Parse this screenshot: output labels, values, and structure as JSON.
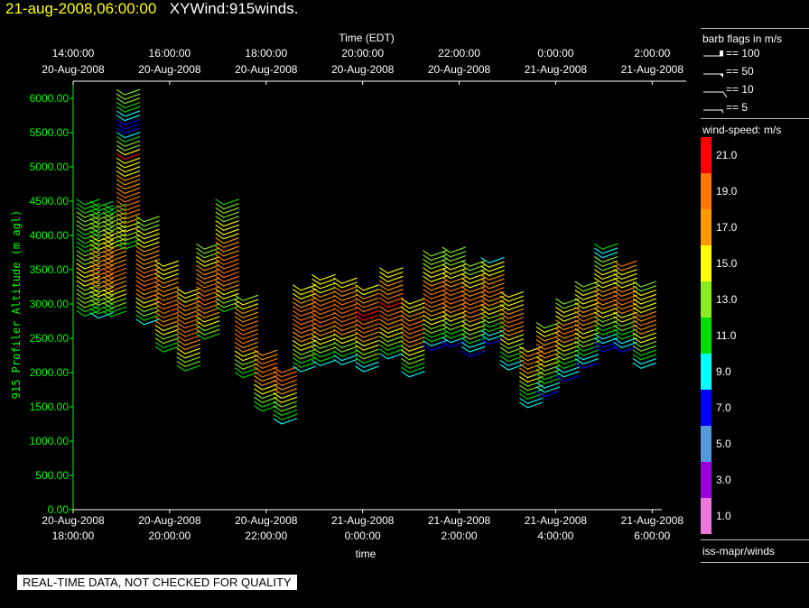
{
  "header": {
    "date_label": "21-aug-2008,06:00:00",
    "title": "XYWind:915winds."
  },
  "notice": "REAL-TIME DATA, NOT CHECKED FOR QUALITY",
  "legend": {
    "barb_title": "barb flags in m/s",
    "barb_items": [
      "== 100",
      "== 50",
      "== 10",
      "== 5"
    ],
    "colorbar_title": "wind-speed: m/s",
    "colorbar": [
      {
        "label": "21.0",
        "color": "#ff0000"
      },
      {
        "label": "19.0",
        "color": "#ff7700"
      },
      {
        "label": "17.0",
        "color": "#ff9900"
      },
      {
        "label": "15.0",
        "color": "#ffff00"
      },
      {
        "label": "13.0",
        "color": "#88ee22"
      },
      {
        "label": "11.0",
        "color": "#00dd00"
      },
      {
        "label": "9.0",
        "color": "#00ffff"
      },
      {
        "label": "7.0",
        "color": "#0000ff"
      },
      {
        "label": "5.0",
        "color": "#5599dd"
      },
      {
        "label": "3.0",
        "color": "#9900dd"
      },
      {
        "label": "1.0",
        "color": "#ee77dd"
      }
    ],
    "source": "iss-mapr/winds"
  },
  "chart_data": {
    "type": "scatter",
    "title": "XYWind:915winds.",
    "ylabel": "915 Profiler Altitude (m agl)",
    "xlabel_bottom": "time",
    "xlabel_top": "Time (EDT)",
    "ylim": [
      0,
      6250
    ],
    "yticks": [
      "0.00",
      "500.00",
      "1000.00",
      "1500.00",
      "2000.00",
      "2500.00",
      "3000.00",
      "3500.00",
      "4000.00",
      "4500.00",
      "5000.00",
      "5500.00",
      "6000.00"
    ],
    "xlim_hours_utc": [
      18.0,
      30.2
    ],
    "xticks_bottom": [
      {
        "hour": 18,
        "line1": "20-Aug-2008",
        "line2": "18:00:00"
      },
      {
        "hour": 20,
        "line1": "20-Aug-2008",
        "line2": "20:00:00"
      },
      {
        "hour": 22,
        "line1": "20-Aug-2008",
        "line2": "22:00:00"
      },
      {
        "hour": 24,
        "line1": "21-Aug-2008",
        "line2": "0:00:00"
      },
      {
        "hour": 26,
        "line1": "21-Aug-2008",
        "line2": "2:00:00"
      },
      {
        "hour": 28,
        "line1": "21-Aug-2008",
        "line2": "4:00:00"
      },
      {
        "hour": 30,
        "line1": "21-Aug-2008",
        "line2": "6:00:00"
      }
    ],
    "xticks_top": [
      {
        "hour": 18,
        "line1": "14:00:00",
        "line2": "20-Aug-2008"
      },
      {
        "hour": 20,
        "line1": "16:00:00",
        "line2": "20-Aug-2008"
      },
      {
        "hour": 22,
        "line1": "18:00:00",
        "line2": "20-Aug-2008"
      },
      {
        "hour": 24,
        "line1": "20:00:00",
        "line2": "20-Aug-2008"
      },
      {
        "hour": 26,
        "line1": "22:00:00",
        "line2": "20-Aug-2008"
      },
      {
        "hour": 28,
        "line1": "0:00:00",
        "line2": "21-Aug-2008"
      },
      {
        "hour": 30,
        "line1": "2:00:00",
        "line2": "21-Aug-2008"
      }
    ],
    "grid": false,
    "colors": {
      "axis_left": "#00ff00",
      "axis": "#ffffff"
    },
    "profiles": [
      {
        "hour": 18.07,
        "top": 4450,
        "speeds": [
          11,
          11,
          12,
          12,
          13,
          13,
          13,
          14,
          15,
          15,
          15,
          14,
          13,
          12,
          12,
          11,
          11,
          11,
          10,
          10,
          13,
          13,
          13,
          12,
          11,
          11,
          11
        ]
      },
      {
        "hour": 18.35,
        "top": 4420,
        "speeds": [
          9,
          10,
          11,
          12,
          13,
          14,
          15,
          16,
          17,
          17,
          18,
          18,
          17,
          17,
          16,
          16,
          15,
          15,
          14,
          13,
          13,
          13,
          12,
          12,
          11,
          11,
          11
        ]
      },
      {
        "hour": 18.62,
        "top": 4380,
        "speeds": [
          10,
          11,
          12,
          13,
          14,
          15,
          16,
          17,
          17,
          18,
          18,
          18,
          17,
          17,
          16,
          16,
          15,
          15,
          14,
          14,
          13,
          13,
          12,
          12,
          11,
          11
        ]
      },
      {
        "hour": 18.9,
        "top": 6050,
        "speeds": [
          10,
          11,
          12,
          13,
          14,
          15,
          16,
          17,
          18,
          18,
          19,
          18,
          18,
          17,
          17,
          16,
          16,
          15,
          15,
          14,
          14,
          21,
          14,
          13,
          12,
          11,
          9,
          7,
          7,
          7,
          8,
          9,
          11,
          11,
          12,
          12,
          12
        ]
      },
      {
        "hour": 19.3,
        "top": 4200,
        "speeds": [
          9,
          10,
          12,
          13,
          14,
          15,
          16,
          17,
          18,
          18,
          19,
          18,
          18,
          17,
          17,
          17,
          16,
          16,
          15,
          15,
          14,
          14,
          13,
          13,
          13
        ]
      },
      {
        "hour": 19.7,
        "top": 3550,
        "speeds": [
          10,
          11,
          12,
          13,
          14,
          15,
          16,
          17,
          18,
          18,
          19,
          18,
          18,
          17,
          17,
          16,
          16,
          15,
          15,
          14,
          14
        ]
      },
      {
        "hour": 20.15,
        "top": 3150,
        "speeds": [
          11,
          12,
          13,
          14,
          15,
          16,
          17,
          18,
          18,
          19,
          18,
          18,
          17,
          17,
          16,
          16,
          15,
          15,
          14
        ]
      },
      {
        "hour": 20.55,
        "top": 3800,
        "speeds": [
          11,
          12,
          13,
          14,
          15,
          16,
          17,
          18,
          18,
          19,
          19,
          18,
          18,
          17,
          17,
          16,
          16,
          15,
          14,
          13,
          13,
          12
        ]
      },
      {
        "hour": 20.95,
        "top": 4450,
        "speeds": [
          11,
          12,
          13,
          14,
          15,
          16,
          17,
          18,
          18,
          19,
          19,
          18,
          18,
          17,
          17,
          16,
          16,
          15,
          15,
          14,
          14,
          13,
          13,
          12,
          12,
          11
        ]
      },
      {
        "hour": 21.35,
        "top": 3050,
        "speeds": [
          10,
          11,
          12,
          13,
          14,
          15,
          16,
          17,
          18,
          18,
          19,
          18,
          18,
          17,
          17,
          16,
          15,
          14,
          13
        ]
      },
      {
        "hour": 21.75,
        "top": 2250,
        "speeds": [
          10,
          11,
          12,
          13,
          14,
          15,
          16,
          17,
          18,
          18,
          19,
          18,
          17,
          16
        ]
      },
      {
        "hour": 22.15,
        "top": 2000,
        "speeds": [
          9,
          10,
          11,
          12,
          13,
          14,
          15,
          16,
          17,
          18,
          18,
          19,
          18
        ]
      },
      {
        "hour": 22.55,
        "top": 3200,
        "speeds": [
          9,
          10,
          11,
          12,
          13,
          14,
          15,
          16,
          17,
          18,
          18,
          19,
          19,
          18,
          18,
          17,
          16,
          15,
          14,
          14
        ]
      },
      {
        "hour": 22.95,
        "top": 3350,
        "speeds": [
          8,
          10,
          11,
          12,
          13,
          14,
          15,
          16,
          17,
          18,
          18,
          19,
          19,
          18,
          18,
          17,
          16,
          15,
          15,
          14,
          14
        ]
      },
      {
        "hour": 23.4,
        "top": 3300,
        "speeds": [
          8,
          9,
          11,
          12,
          13,
          14,
          15,
          16,
          17,
          18,
          18,
          19,
          19,
          18,
          18,
          17,
          16,
          16,
          15,
          15
        ]
      },
      {
        "hour": 23.85,
        "top": 3200,
        "speeds": [
          8,
          9,
          10,
          12,
          13,
          14,
          15,
          16,
          17,
          18,
          19,
          19,
          20,
          21,
          19,
          18,
          17,
          16,
          15,
          15
        ]
      },
      {
        "hour": 24.35,
        "top": 3450,
        "speeds": [
          9,
          10,
          11,
          12,
          13,
          14,
          15,
          16,
          17,
          18,
          19,
          19,
          20,
          19,
          18,
          17,
          16,
          16,
          15,
          15,
          15
        ]
      },
      {
        "hour": 24.8,
        "top": 3000,
        "speeds": [
          9,
          10,
          11,
          12,
          13,
          14,
          15,
          16,
          17,
          18,
          19,
          19,
          18,
          17,
          16,
          15,
          15,
          15
        ]
      },
      {
        "hour": 25.25,
        "top": 3700,
        "speeds": [
          7,
          9,
          10,
          11,
          12,
          13,
          14,
          15,
          16,
          17,
          18,
          19,
          19,
          18,
          17,
          16,
          15,
          14,
          14,
          13,
          13,
          12,
          12
        ]
      },
      {
        "hour": 25.65,
        "top": 3750,
        "speeds": [
          7,
          8,
          10,
          11,
          12,
          13,
          14,
          15,
          16,
          17,
          18,
          18,
          19,
          18,
          17,
          16,
          15,
          14,
          14,
          13,
          13,
          12,
          12
        ]
      },
      {
        "hour": 26.05,
        "top": 3550,
        "speeds": [
          7,
          8,
          9,
          11,
          12,
          13,
          14,
          15,
          16,
          17,
          18,
          18,
          19,
          18,
          17,
          16,
          15,
          15,
          14,
          13,
          13,
          12
        ]
      },
      {
        "hour": 26.45,
        "top": 3600,
        "speeds": [
          7,
          8,
          9,
          10,
          11,
          12,
          13,
          14,
          15,
          16,
          17,
          18,
          18,
          17,
          16,
          16,
          15,
          14,
          14,
          9
        ]
      },
      {
        "hour": 26.85,
        "top": 3100,
        "speeds": [
          8,
          9,
          10,
          11,
          12,
          13,
          14,
          15,
          16,
          17,
          18,
          18,
          17,
          16,
          15,
          15,
          14,
          14
        ]
      },
      {
        "hour": 27.25,
        "top": 2300,
        "speeds": [
          8,
          9,
          10,
          11,
          12,
          13,
          14,
          15,
          16,
          17,
          18,
          17,
          16,
          15
        ]
      },
      {
        "hour": 27.6,
        "top": 2650,
        "speeds": [
          7,
          8,
          9,
          10,
          11,
          12,
          13,
          14,
          15,
          16,
          17,
          18,
          17,
          16,
          15,
          14,
          13
        ]
      },
      {
        "hour": 28.0,
        "top": 3000,
        "speeds": [
          7,
          8,
          9,
          10,
          11,
          12,
          13,
          14,
          15,
          16,
          17,
          18,
          17,
          16,
          15,
          14,
          14,
          13,
          13
        ]
      },
      {
        "hour": 28.4,
        "top": 3250,
        "speeds": [
          7,
          8,
          9,
          10,
          11,
          12,
          13,
          14,
          15,
          16,
          17,
          18,
          17,
          16,
          15,
          15,
          14,
          14,
          13,
          13
        ]
      },
      {
        "hour": 28.8,
        "top": 3800,
        "speeds": [
          7,
          7,
          8,
          9,
          10,
          11,
          12,
          13,
          14,
          15,
          16,
          17,
          18,
          17,
          16,
          15,
          15,
          14,
          14,
          13,
          13,
          12,
          9,
          9,
          11
        ]
      },
      {
        "hour": 29.2,
        "top": 3550,
        "speeds": [
          7,
          8,
          9,
          10,
          11,
          12,
          13,
          14,
          15,
          16,
          17,
          18,
          18,
          17,
          16,
          15,
          15,
          15,
          15,
          17,
          18
        ]
      },
      {
        "hour": 29.6,
        "top": 3250,
        "speeds": [
          8,
          9,
          10,
          11,
          12,
          13,
          14,
          15,
          16,
          17,
          18,
          17,
          16,
          15,
          14,
          14,
          14,
          14,
          13,
          13
        ]
      }
    ]
  }
}
